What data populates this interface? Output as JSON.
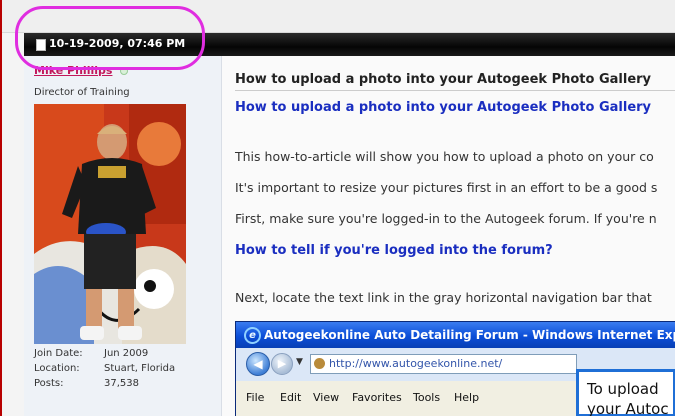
{
  "post": {
    "date": "10-19-2009, 07:46 PM"
  },
  "user": {
    "name": "Mike Phillips",
    "title": "Director of Training",
    "stats": [
      {
        "label": "Join Date:",
        "value": "Jun 2009"
      },
      {
        "label": "Location:",
        "value": "Stuart, Florida"
      },
      {
        "label": "Posts:",
        "value": "37,538"
      }
    ]
  },
  "content": {
    "heading": "How to upload a photo into your Autogeek Photo Gallery",
    "title_link": "How to upload a photo into your Autogeek Photo Gallery",
    "para1": "This how-to-article will show you how to upload a photo on your co",
    "para2": "It's important to resize your pictures first in an effort to be a good s",
    "para3": "First, make sure you're logged-in to the Autogeek forum. If you're n",
    "logged_link": "How to tell if you're logged into the forum?",
    "para4": "Next, locate the text link in the gray horizontal navigation bar that"
  },
  "screenshot": {
    "window_title": "Autogeekonline Auto Detailing Forum - Windows Internet Explorer",
    "url": "http://www.autogeekonline.net/",
    "menu": [
      "File",
      "Edit",
      "View",
      "Favorites",
      "Tools",
      "Help"
    ],
    "overlay_line1": "To upload",
    "overlay_line2": "your Autoc"
  },
  "colors": {
    "username": "#c2185b",
    "link": "#1a2ec0",
    "highlight_circle": "#e02de0"
  }
}
